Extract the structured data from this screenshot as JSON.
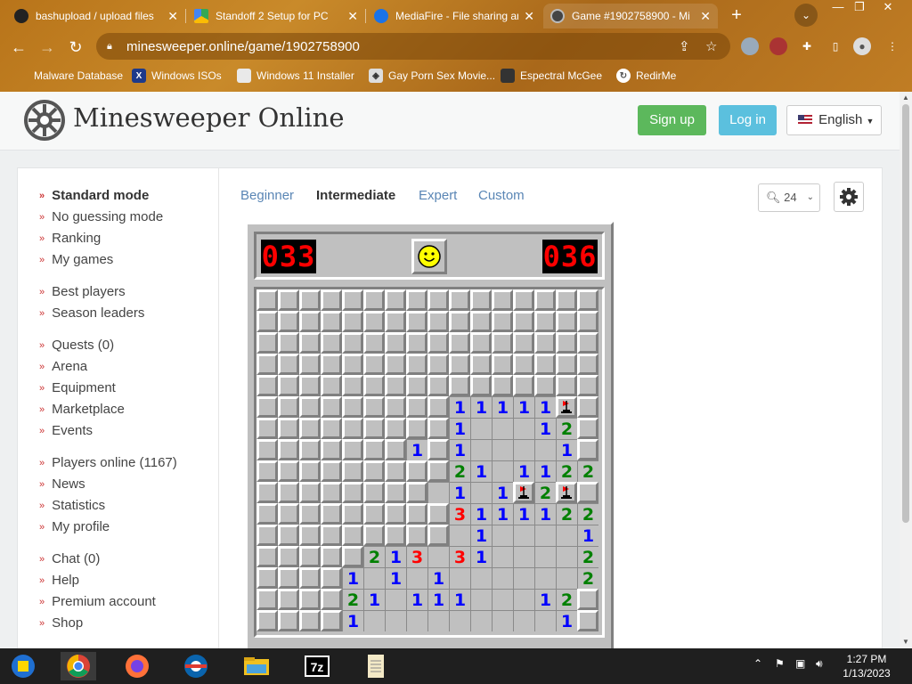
{
  "browser": {
    "tabs": [
      {
        "title": "bashupload / upload files",
        "active": false
      },
      {
        "title": "Standoff 2 Setup for PC",
        "active": false
      },
      {
        "title": "MediaFire - File sharing an",
        "active": false
      },
      {
        "title": "Game #1902758900 - Mi",
        "active": true
      }
    ],
    "url": "minesweeper.online/game/1902758900",
    "bookmarks": [
      "Malware Database",
      "Windows ISOs",
      "Windows 11 Installer",
      "Gay Porn Sex Movie...",
      "Espectral McGee",
      "RedirMe"
    ]
  },
  "site": {
    "name": "Minesweeper Online",
    "signup": "Sign up",
    "login": "Log in",
    "language": "English"
  },
  "sidebar": {
    "items": [
      {
        "label": "Standard mode",
        "bold": true
      },
      {
        "label": "No guessing mode"
      },
      {
        "label": "Ranking"
      },
      {
        "label": "My games"
      },
      {
        "label": "Best players"
      },
      {
        "label": "Season leaders"
      },
      {
        "label": "Quests (0)"
      },
      {
        "label": "Arena"
      },
      {
        "label": "Equipment"
      },
      {
        "label": "Marketplace"
      },
      {
        "label": "Events"
      },
      {
        "label": "Players online (1167)"
      },
      {
        "label": "News"
      },
      {
        "label": "Statistics"
      },
      {
        "label": "My profile"
      },
      {
        "label": "Chat (0)"
      },
      {
        "label": "Help"
      },
      {
        "label": "Premium account"
      },
      {
        "label": "Shop"
      }
    ]
  },
  "modes": [
    "Beginner",
    "Intermediate",
    "Expert",
    "Custom"
  ],
  "active_mode": "Intermediate",
  "zoom": "24",
  "game": {
    "mines_left": "033",
    "timer": "036",
    "board": [
      "################",
      "################",
      "################",
      "################",
      "################",
      "#########11111F##",
      "#########1...12##",
      "#######1#1....1##",
      "#########21.1122",
      "########.1.1F2F#",
      "#########3111122",
      "#########.1....1#",
      "#####213.31....2#",
      "####1.1.1......2#",
      "####21.111...12#",
      "####1.........1#"
    ]
  },
  "taskbar": {
    "time": "1:27 PM",
    "date": "1/13/2023",
    "apps": [
      "start",
      "chrome",
      "firefox",
      "office",
      "file-explorer",
      "7zip",
      "notepad"
    ]
  },
  "colors": {
    "signup": "#5cb85c",
    "login": "#5bc0de",
    "counter": "#ff0000",
    "n1": "#0000ff",
    "n2": "#008000",
    "n3": "#ff0000"
  }
}
